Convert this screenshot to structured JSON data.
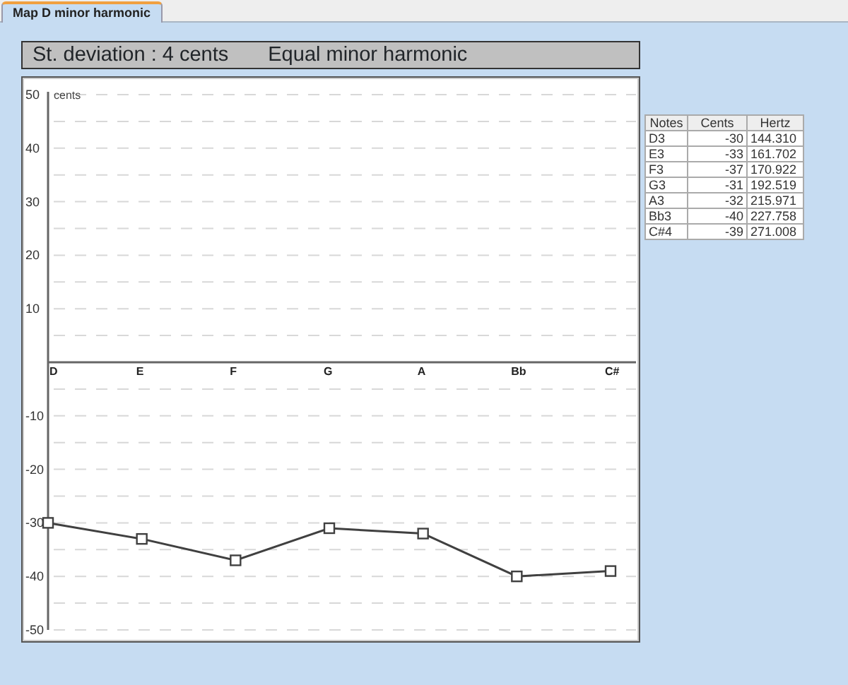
{
  "tabs": [
    {
      "label": "Map D minor harmonic",
      "selected": true
    }
  ],
  "header": {
    "deviation": "St. deviation : 4 cents",
    "temperament": "Equal minor harmonic"
  },
  "chart": {
    "chart_data": {
      "type": "line",
      "ylabel": "cents",
      "categories": [
        "D",
        "E",
        "F",
        "G",
        "A",
        "Bb",
        "C#"
      ],
      "series": [
        {
          "color": "#404040",
          "marker": "square",
          "values": [
            -30,
            -33,
            -37,
            -31,
            -32,
            -40,
            -39
          ]
        }
      ],
      "grid": true,
      "ylim": [
        -50,
        50
      ],
      "yticks": [
        50,
        40,
        30,
        20,
        10,
        -10,
        -20,
        -30,
        -40,
        -50
      ]
    }
  },
  "notes_table": {
    "columns": [
      "Notes",
      "Cents",
      "Hertz"
    ],
    "rows": [
      [
        "D3",
        "-30",
        "144.310"
      ],
      [
        "E3",
        "-33",
        "161.702"
      ],
      [
        "F3",
        "-37",
        "170.922"
      ],
      [
        "G3",
        "-31",
        "192.519"
      ],
      [
        "A3",
        "-32",
        "215.971"
      ],
      [
        "Bb3",
        "-40",
        "227.758"
      ],
      [
        "C#4",
        "-39",
        "271.008"
      ]
    ]
  }
}
